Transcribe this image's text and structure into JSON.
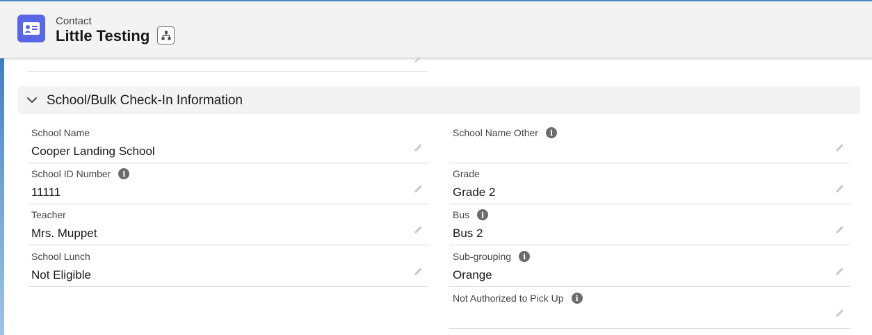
{
  "header": {
    "object_label": "Contact",
    "record_title": "Little Testing",
    "icon": "contact-card-icon",
    "hierarchy_icon": "hierarchy-icon",
    "accent_color": "#5867e8"
  },
  "section": {
    "title": "School/Bulk Check-In Information",
    "expanded": true
  },
  "fields": {
    "school_name": {
      "label": "School Name",
      "value": "Cooper Landing School"
    },
    "school_name_other": {
      "label": "School Name Other",
      "value": "",
      "has_help": true
    },
    "school_id_number": {
      "label": "School ID Number",
      "value": "11111",
      "has_help": true
    },
    "grade": {
      "label": "Grade",
      "value": "Grade 2"
    },
    "teacher": {
      "label": "Teacher",
      "value": "Mrs. Muppet"
    },
    "bus": {
      "label": "Bus",
      "value": "Bus 2",
      "has_help": true
    },
    "school_lunch": {
      "label": "School Lunch",
      "value": "Not Eligible"
    },
    "sub_grouping": {
      "label": "Sub-grouping",
      "value": "Orange",
      "has_help": true
    },
    "not_authorized": {
      "label": "Not Authorized to Pick Up",
      "value": "",
      "has_help": true
    }
  },
  "icons": {
    "edit": "pencil-icon",
    "help": "info-icon",
    "info_glyph": "i"
  }
}
